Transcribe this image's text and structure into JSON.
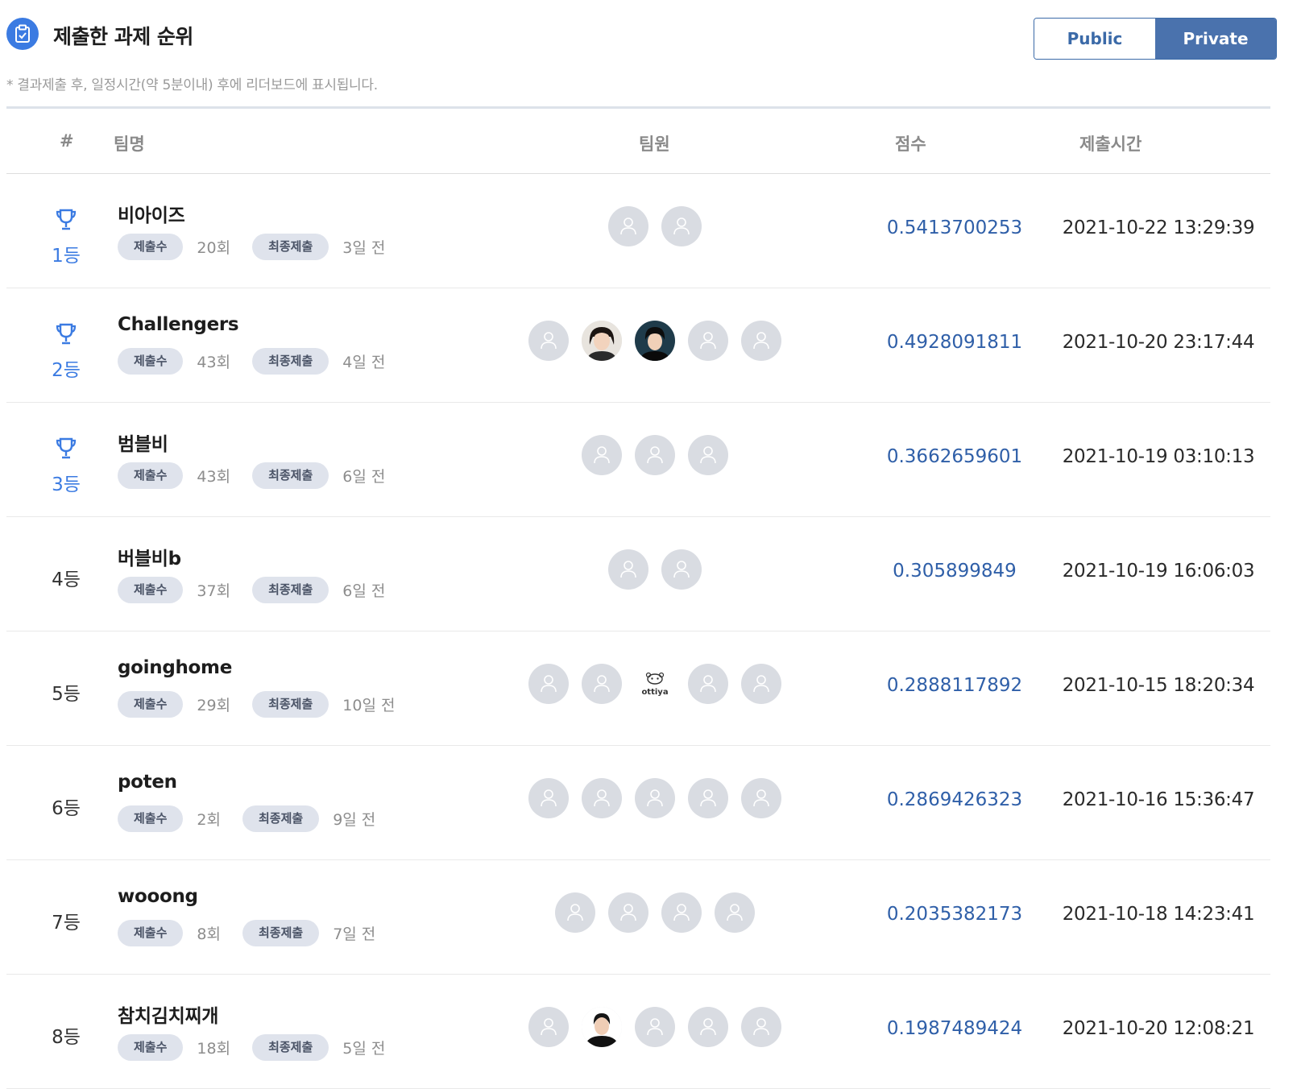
{
  "header": {
    "title": "제출한 과제 순위",
    "toggle": {
      "public_label": "Public",
      "private_label": "Private",
      "selected": "Private"
    },
    "note": "* 결과제출 후, 일정시간(약 5분이내) 후에 리더보드에 표시됩니다."
  },
  "table": {
    "columns": {
      "rank": "#",
      "team": "팀명",
      "members": "팀원",
      "score": "점수",
      "time": "제출시간"
    },
    "submissions_label": "제출수",
    "last_label": "최종제출",
    "rows": [
      {
        "rank": "1등",
        "trophy": true,
        "team": "비아이즈",
        "submissions": "20회",
        "last": "3일 전",
        "members": [
          "default-avatar",
          "default-avatar"
        ],
        "score": "0.5413700253",
        "time": "2021-10-22 13:29:39"
      },
      {
        "rank": "2등",
        "trophy": true,
        "team": "Challengers",
        "submissions": "43회",
        "last": "4일 전",
        "members": [
          "default-avatar",
          "photo-avatar-woman",
          "photo-avatar-man",
          "default-avatar",
          "default-avatar"
        ],
        "score": "0.4928091811",
        "time": "2021-10-20 23:17:44"
      },
      {
        "rank": "3등",
        "trophy": true,
        "team": "범블비",
        "submissions": "43회",
        "last": "6일 전",
        "members": [
          "default-avatar",
          "default-avatar",
          "default-avatar"
        ],
        "score": "0.3662659601",
        "time": "2021-10-19 03:10:13"
      },
      {
        "rank": "4등",
        "trophy": false,
        "team": "버블비b",
        "submissions": "37회",
        "last": "6일 전",
        "members": [
          "default-avatar",
          "default-avatar"
        ],
        "score": "0.305899849",
        "time": "2021-10-19 16:06:03"
      },
      {
        "rank": "5등",
        "trophy": false,
        "team": "goinghome",
        "submissions": "29회",
        "last": "10일 전",
        "members": [
          "default-avatar",
          "default-avatar",
          "ottiya-logo-avatar",
          "default-avatar",
          "default-avatar"
        ],
        "ottiya_text": "ottiya",
        "score": "0.2888117892",
        "time": "2021-10-15 18:20:34"
      },
      {
        "rank": "6등",
        "trophy": false,
        "team": "poten",
        "submissions": "2회",
        "last": "9일 전",
        "members": [
          "default-avatar",
          "default-avatar",
          "default-avatar",
          "default-avatar",
          "default-avatar"
        ],
        "score": "0.2869426323",
        "time": "2021-10-16 15:36:47"
      },
      {
        "rank": "7등",
        "trophy": false,
        "team": "wooong",
        "submissions": "8회",
        "last": "7일 전",
        "members": [
          "default-avatar",
          "default-avatar",
          "default-avatar",
          "default-avatar"
        ],
        "score": "0.2035382173",
        "time": "2021-10-18 14:23:41"
      },
      {
        "rank": "8등",
        "trophy": false,
        "team": "참치김치찌개",
        "submissions": "18회",
        "last": "5일 전",
        "members": [
          "default-avatar",
          "photo-avatar-man",
          "default-avatar",
          "default-avatar",
          "default-avatar"
        ],
        "score": "0.1987489424",
        "time": "2021-10-20 12:08:21"
      }
    ]
  },
  "colors": {
    "accent": "#3b7be2",
    "score_text": "#2f5fa8",
    "toggle_active_bg": "#4a72ad",
    "pill_bg": "#dfe3ec",
    "avatar_placeholder": "#d9dce2"
  }
}
